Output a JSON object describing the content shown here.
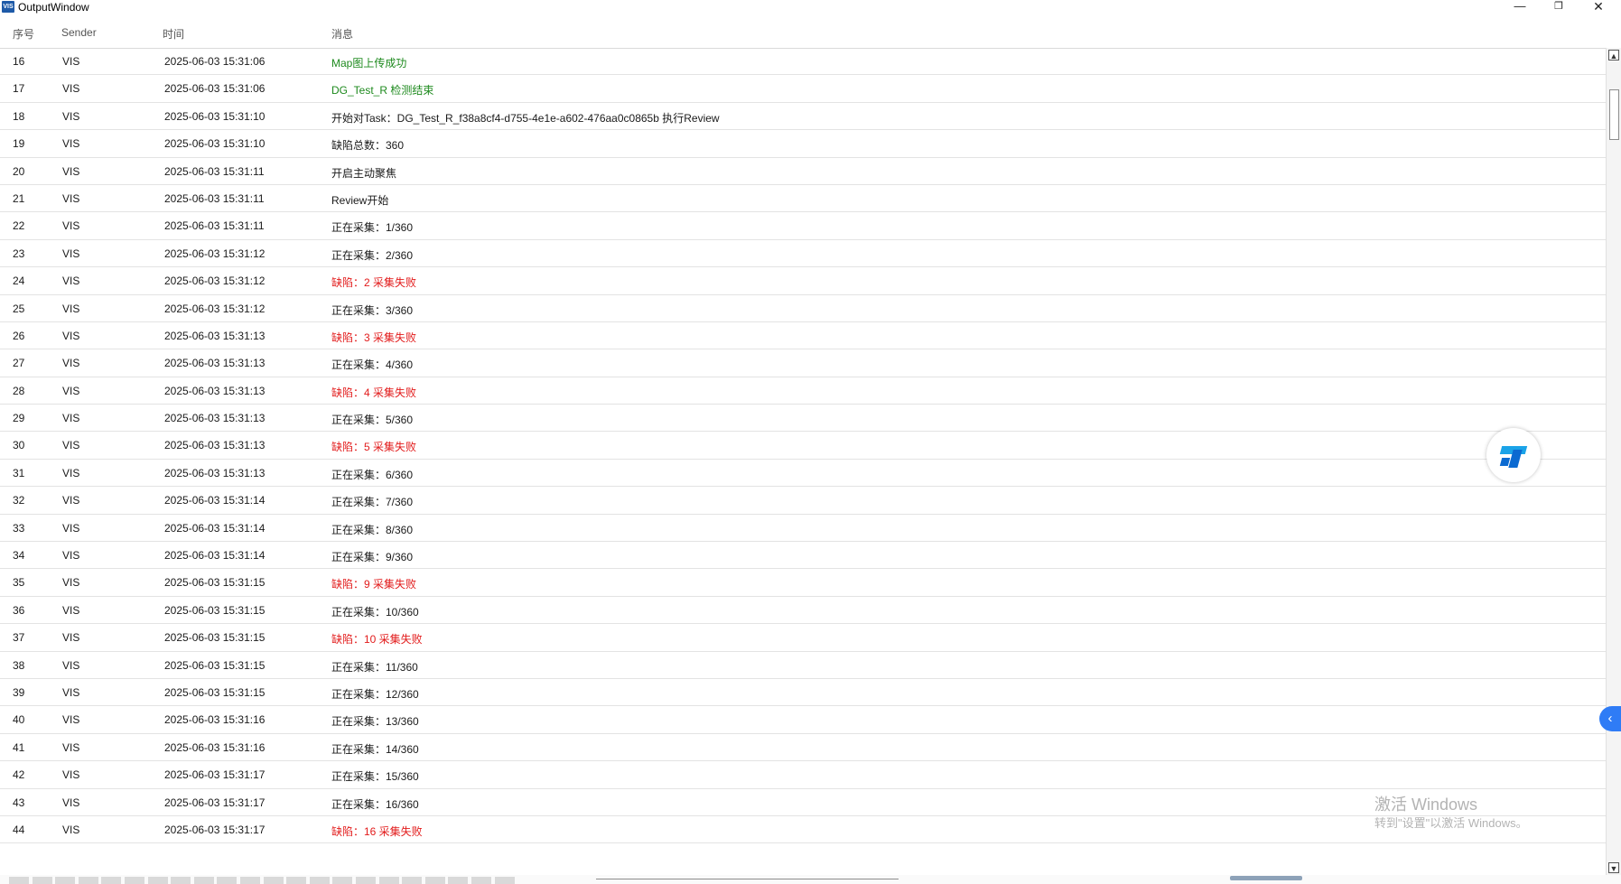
{
  "window": {
    "title": "OutputWindow",
    "icon_text": "VIS",
    "minimize_glyph": "—",
    "restore_glyph": "❐",
    "close_glyph": "✕"
  },
  "columns": {
    "index": "序号",
    "sender": "Sender",
    "time": "时间",
    "message": "消息"
  },
  "rows": [
    {
      "idx": "16",
      "sender": "VIS",
      "time": "2025-06-03 15:31:06",
      "msg": "Map图上传成功",
      "level": "success"
    },
    {
      "idx": "17",
      "sender": "VIS",
      "time": "2025-06-03 15:31:06",
      "msg": "DG_Test_R 检测结束",
      "level": "success"
    },
    {
      "idx": "18",
      "sender": "VIS",
      "time": "2025-06-03 15:31:10",
      "msg": "开始对Task：DG_Test_R_f38a8cf4-d755-4e1e-a602-476aa0c0865b 执行Review",
      "level": "info"
    },
    {
      "idx": "19",
      "sender": "VIS",
      "time": "2025-06-03 15:31:10",
      "msg": "缺陷总数：360",
      "level": "info"
    },
    {
      "idx": "20",
      "sender": "VIS",
      "time": "2025-06-03 15:31:11",
      "msg": "开启主动聚焦",
      "level": "info"
    },
    {
      "idx": "21",
      "sender": "VIS",
      "time": "2025-06-03 15:31:11",
      "msg": "Review开始",
      "level": "info"
    },
    {
      "idx": "22",
      "sender": "VIS",
      "time": "2025-06-03 15:31:11",
      "msg": "正在采集：1/360",
      "level": "info"
    },
    {
      "idx": "23",
      "sender": "VIS",
      "time": "2025-06-03 15:31:12",
      "msg": "正在采集：2/360",
      "level": "info"
    },
    {
      "idx": "24",
      "sender": "VIS",
      "time": "2025-06-03 15:31:12",
      "msg": "缺陷：2 采集失败",
      "level": "error"
    },
    {
      "idx": "25",
      "sender": "VIS",
      "time": "2025-06-03 15:31:12",
      "msg": "正在采集：3/360",
      "level": "info"
    },
    {
      "idx": "26",
      "sender": "VIS",
      "time": "2025-06-03 15:31:13",
      "msg": "缺陷：3 采集失败",
      "level": "error"
    },
    {
      "idx": "27",
      "sender": "VIS",
      "time": "2025-06-03 15:31:13",
      "msg": "正在采集：4/360",
      "level": "info"
    },
    {
      "idx": "28",
      "sender": "VIS",
      "time": "2025-06-03 15:31:13",
      "msg": "缺陷：4 采集失败",
      "level": "error"
    },
    {
      "idx": "29",
      "sender": "VIS",
      "time": "2025-06-03 15:31:13",
      "msg": "正在采集：5/360",
      "level": "info"
    },
    {
      "idx": "30",
      "sender": "VIS",
      "time": "2025-06-03 15:31:13",
      "msg": "缺陷：5 采集失败",
      "level": "error"
    },
    {
      "idx": "31",
      "sender": "VIS",
      "time": "2025-06-03 15:31:13",
      "msg": "正在采集：6/360",
      "level": "info"
    },
    {
      "idx": "32",
      "sender": "VIS",
      "time": "2025-06-03 15:31:14",
      "msg": "正在采集：7/360",
      "level": "info"
    },
    {
      "idx": "33",
      "sender": "VIS",
      "time": "2025-06-03 15:31:14",
      "msg": "正在采集：8/360",
      "level": "info"
    },
    {
      "idx": "34",
      "sender": "VIS",
      "time": "2025-06-03 15:31:14",
      "msg": "正在采集：9/360",
      "level": "info"
    },
    {
      "idx": "35",
      "sender": "VIS",
      "time": "2025-06-03 15:31:15",
      "msg": "缺陷：9 采集失败",
      "level": "error"
    },
    {
      "idx": "36",
      "sender": "VIS",
      "time": "2025-06-03 15:31:15",
      "msg": "正在采集：10/360",
      "level": "info"
    },
    {
      "idx": "37",
      "sender": "VIS",
      "time": "2025-06-03 15:31:15",
      "msg": "缺陷：10 采集失败",
      "level": "error"
    },
    {
      "idx": "38",
      "sender": "VIS",
      "time": "2025-06-03 15:31:15",
      "msg": "正在采集：11/360",
      "level": "info"
    },
    {
      "idx": "39",
      "sender": "VIS",
      "time": "2025-06-03 15:31:15",
      "msg": "正在采集：12/360",
      "level": "info"
    },
    {
      "idx": "40",
      "sender": "VIS",
      "time": "2025-06-03 15:31:16",
      "msg": "正在采集：13/360",
      "level": "info"
    },
    {
      "idx": "41",
      "sender": "VIS",
      "time": "2025-06-03 15:31:16",
      "msg": "正在采集：14/360",
      "level": "info"
    },
    {
      "idx": "42",
      "sender": "VIS",
      "time": "2025-06-03 15:31:17",
      "msg": "正在采集：15/360",
      "level": "info"
    },
    {
      "idx": "43",
      "sender": "VIS",
      "time": "2025-06-03 15:31:17",
      "msg": "正在采集：16/360",
      "level": "info"
    },
    {
      "idx": "44",
      "sender": "VIS",
      "time": "2025-06-03 15:31:17",
      "msg": "缺陷：16 采集失败",
      "level": "error"
    }
  ],
  "colors": {
    "success": "#1e8a1e",
    "error": "#e21b1b",
    "info": "#1a1a1a"
  },
  "icons": {
    "scroll_up": "▲",
    "scroll_down": "▼",
    "side_tab": "‹"
  },
  "watermark": {
    "line1": "激活 Windows",
    "line2": "转到\"设置\"以激活 Windows。"
  }
}
